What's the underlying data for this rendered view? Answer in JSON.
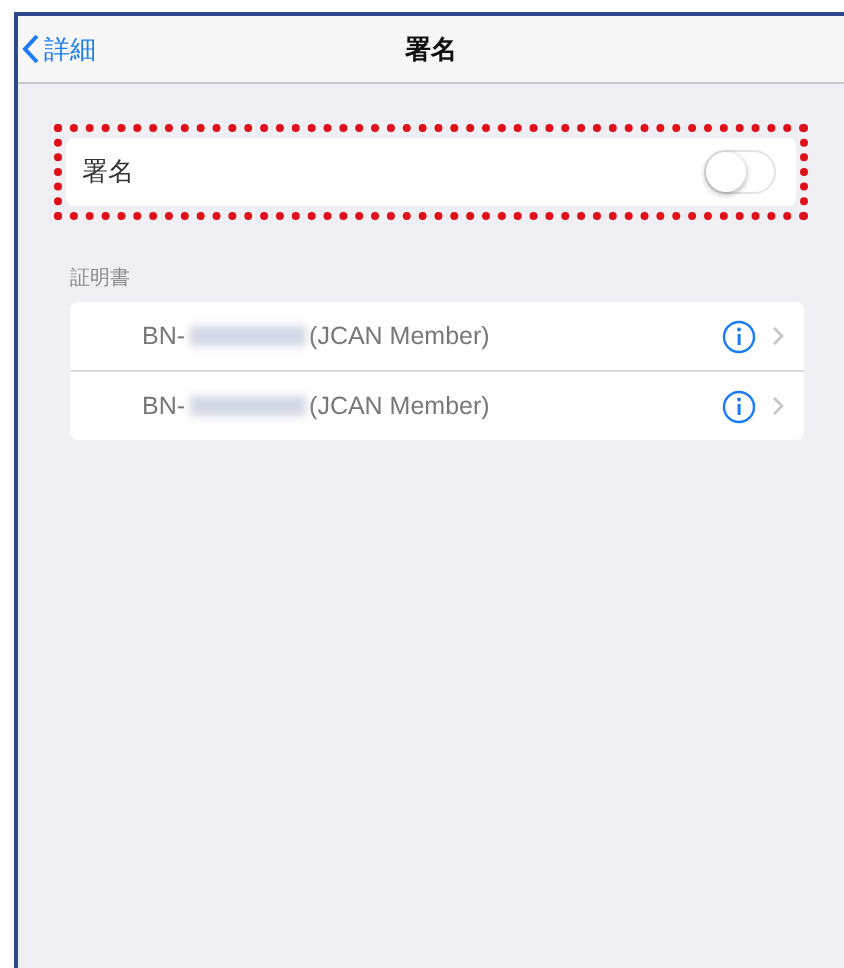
{
  "nav_bar": {
    "back": "詳細",
    "title": "署名"
  },
  "signature": {
    "label": "署名",
    "on": false,
    "highlighted": true
  },
  "certificates": {
    "header": "証明書",
    "items": [
      {
        "prefix": "BN-",
        "suffix": "(JCAN Member)"
      },
      {
        "prefix": "BN-",
        "suffix": "(JCAN Member)"
      }
    ]
  }
}
